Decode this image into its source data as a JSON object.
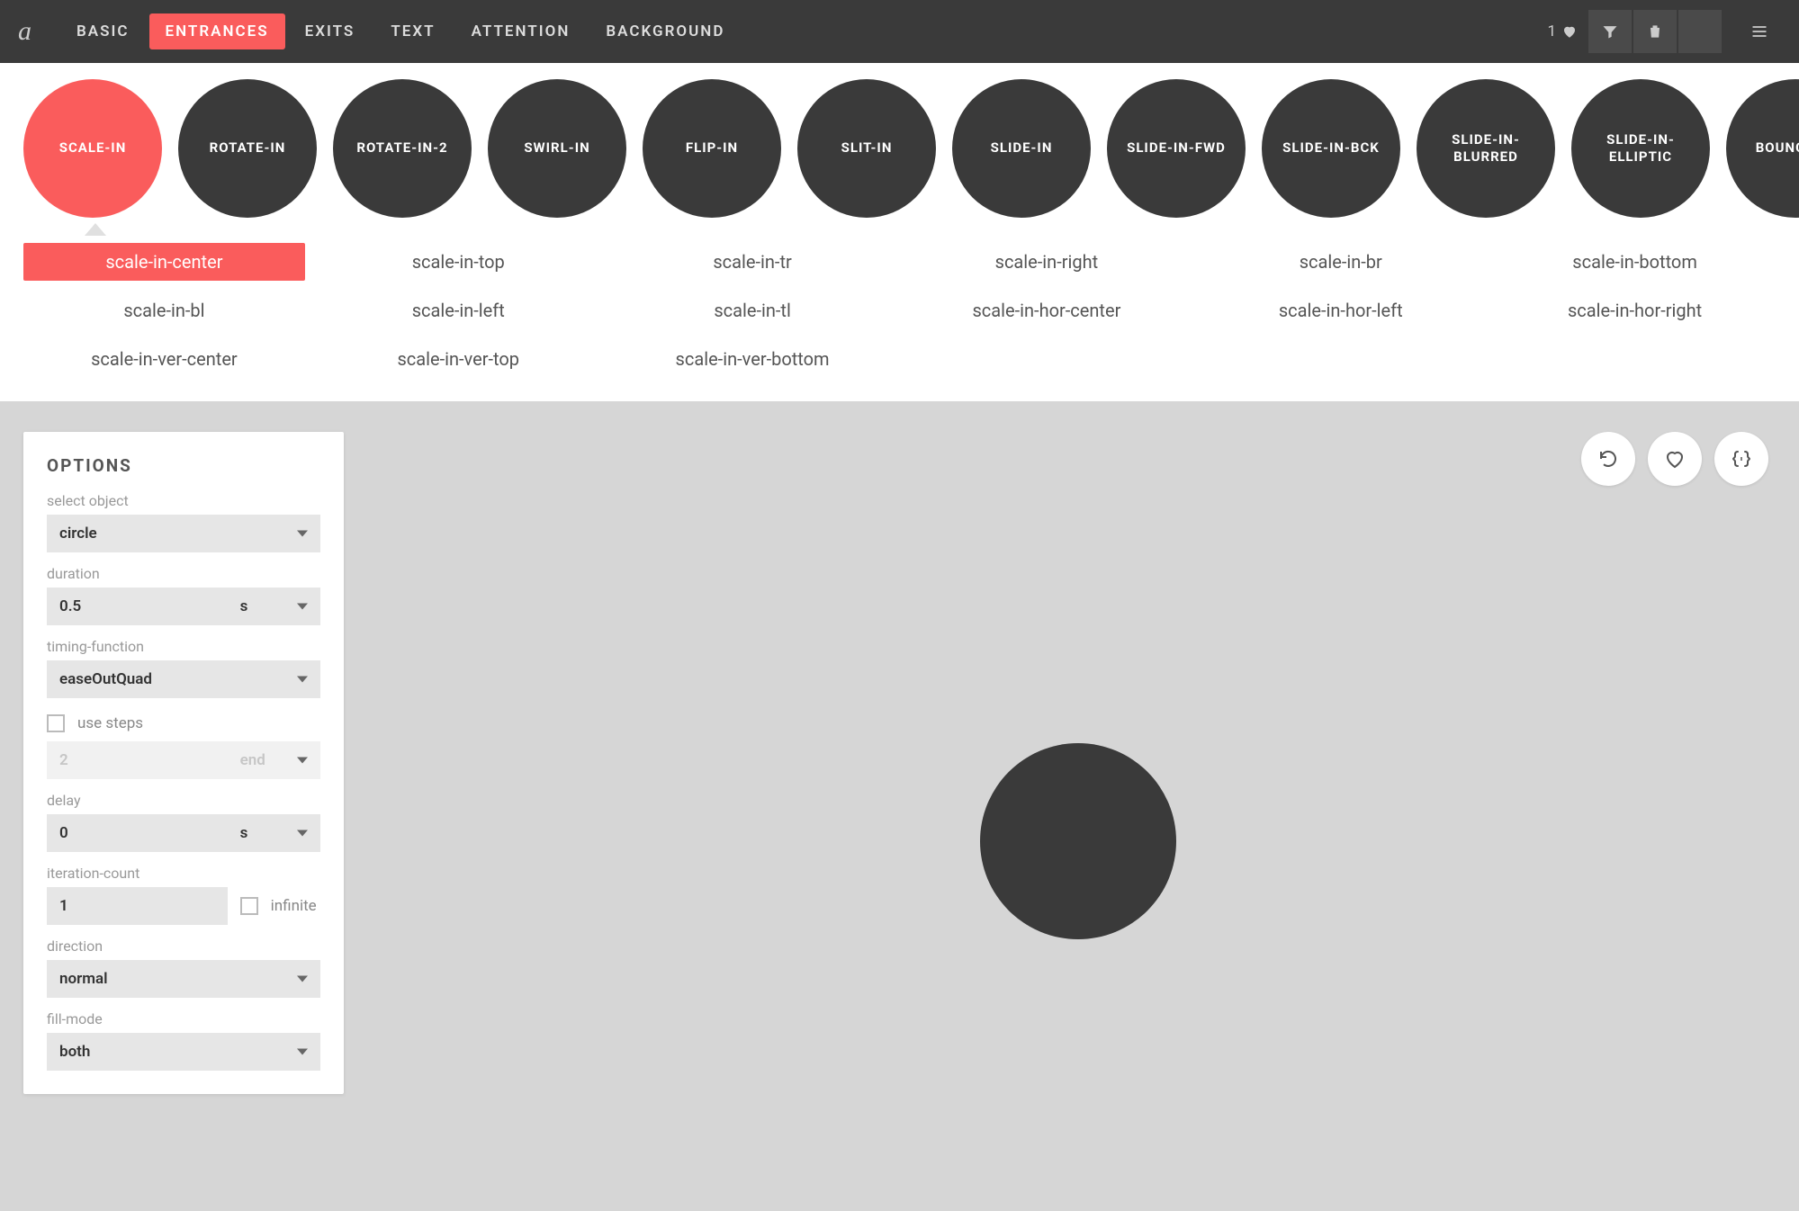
{
  "topbar": {
    "logo": "a",
    "tabs": [
      {
        "label": "BASIC",
        "active": false
      },
      {
        "label": "ENTRANCES",
        "active": true
      },
      {
        "label": "EXITS",
        "active": false
      },
      {
        "label": "TEXT",
        "active": false
      },
      {
        "label": "ATTENTION",
        "active": false
      },
      {
        "label": "BACKGROUND",
        "active": false
      }
    ],
    "fav_count": "1"
  },
  "circles": [
    {
      "label": "SCALE-IN",
      "active": true
    },
    {
      "label": "ROTATE-IN",
      "active": false
    },
    {
      "label": "ROTATE-IN-2",
      "active": false
    },
    {
      "label": "SWIRL-IN",
      "active": false
    },
    {
      "label": "FLIP-IN",
      "active": false
    },
    {
      "label": "SLIT-IN",
      "active": false
    },
    {
      "label": "SLIDE-IN",
      "active": false
    },
    {
      "label": "SLIDE-IN-FWD",
      "active": false
    },
    {
      "label": "SLIDE-IN-BCK",
      "active": false
    },
    {
      "label": "SLIDE-IN-BLURRED",
      "active": false
    },
    {
      "label": "SLIDE-IN-ELLIPTIC",
      "active": false
    },
    {
      "label": "BOUNCE-IN",
      "active": false
    }
  ],
  "variants": [
    {
      "label": "scale-in-center",
      "active": true
    },
    {
      "label": "scale-in-top",
      "active": false
    },
    {
      "label": "scale-in-tr",
      "active": false
    },
    {
      "label": "scale-in-right",
      "active": false
    },
    {
      "label": "scale-in-br",
      "active": false
    },
    {
      "label": "scale-in-bottom",
      "active": false
    },
    {
      "label": "scale-in-bl",
      "active": false
    },
    {
      "label": "scale-in-left",
      "active": false
    },
    {
      "label": "scale-in-tl",
      "active": false
    },
    {
      "label": "scale-in-hor-center",
      "active": false
    },
    {
      "label": "scale-in-hor-left",
      "active": false
    },
    {
      "label": "scale-in-hor-right",
      "active": false
    },
    {
      "label": "scale-in-ver-center",
      "active": false
    },
    {
      "label": "scale-in-ver-top",
      "active": false
    },
    {
      "label": "scale-in-ver-bottom",
      "active": false
    }
  ],
  "options": {
    "title": "OPTIONS",
    "select_object_label": "select object",
    "select_object_value": "circle",
    "duration_label": "duration",
    "duration_value": "0.5",
    "duration_unit": "s",
    "timing_label": "timing-function",
    "timing_value": "easeOutQuad",
    "use_steps_label": "use steps",
    "steps_value": "2",
    "steps_pos": "end",
    "delay_label": "delay",
    "delay_value": "0",
    "delay_unit": "s",
    "iteration_label": "iteration-count",
    "iteration_value": "1",
    "infinite_label": "infinite",
    "direction_label": "direction",
    "direction_value": "normal",
    "fill_label": "fill-mode",
    "fill_value": "both"
  }
}
